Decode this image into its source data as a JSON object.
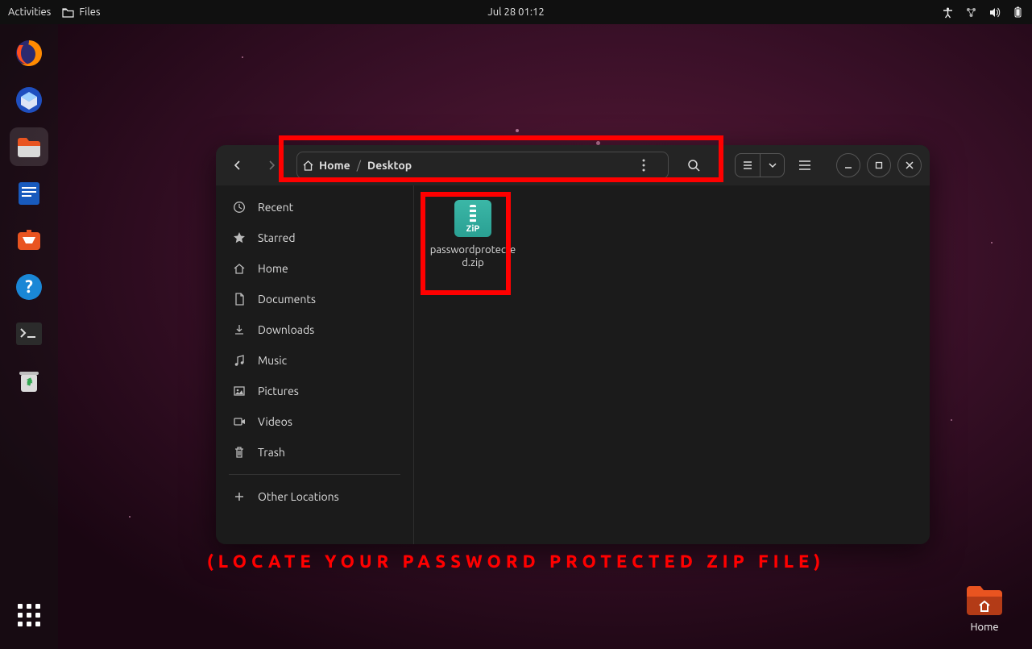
{
  "top_panel": {
    "activities": "Activities",
    "app_indicator": "Files",
    "clock": "Jul 28  01:12"
  },
  "dock": {
    "apps": [
      {
        "name": "firefox"
      },
      {
        "name": "thunderbird"
      },
      {
        "name": "files",
        "active": true
      },
      {
        "name": "libreoffice-writer"
      },
      {
        "name": "ubuntu-software"
      },
      {
        "name": "help"
      },
      {
        "name": "terminal"
      },
      {
        "name": "trash"
      }
    ]
  },
  "files_window": {
    "breadcrumb": {
      "home": "Home",
      "current": "Desktop"
    },
    "sidebar": {
      "items": [
        {
          "icon": "clock",
          "label": "Recent"
        },
        {
          "icon": "star",
          "label": "Starred"
        },
        {
          "icon": "home",
          "label": "Home"
        },
        {
          "icon": "doc",
          "label": "Documents"
        },
        {
          "icon": "download",
          "label": "Downloads"
        },
        {
          "icon": "music",
          "label": "Music"
        },
        {
          "icon": "picture",
          "label": "Pictures"
        },
        {
          "icon": "video",
          "label": "Videos"
        },
        {
          "icon": "trash",
          "label": "Trash"
        }
      ],
      "other": {
        "icon": "plus",
        "label": "Other Locations"
      }
    },
    "content": {
      "files": [
        {
          "name": "passwordprotected.zip",
          "type": "zip"
        }
      ]
    }
  },
  "desktop": {
    "home_folder_label": "Home"
  },
  "annotation": {
    "text": "(LOCATE YOUR PASSWORD PROTECTED ZIP FILE)"
  }
}
